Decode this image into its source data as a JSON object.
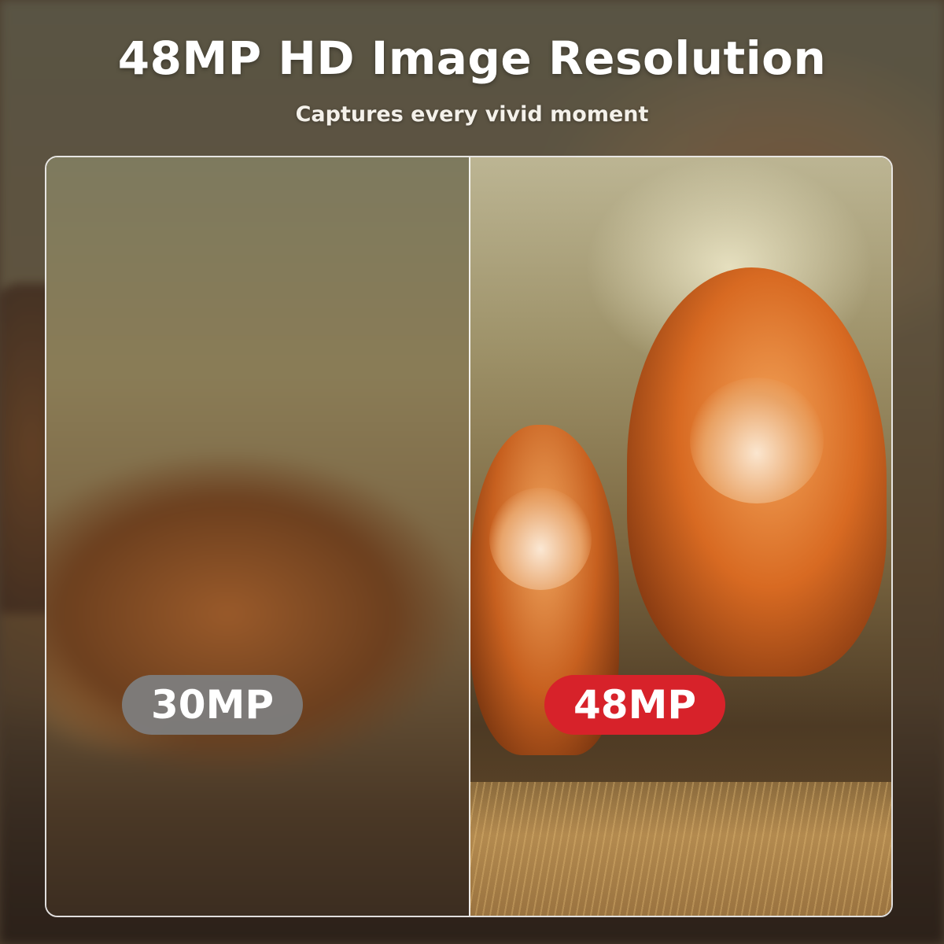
{
  "header": {
    "title": "48MP HD Image Resolution",
    "subtitle": "Captures every vivid moment"
  },
  "comparison": {
    "left_label": "30MP",
    "right_label": "48MP"
  },
  "colors": {
    "left_badge": "#7d7d7d",
    "right_badge": "#d7222a",
    "text": "#ffffff"
  }
}
